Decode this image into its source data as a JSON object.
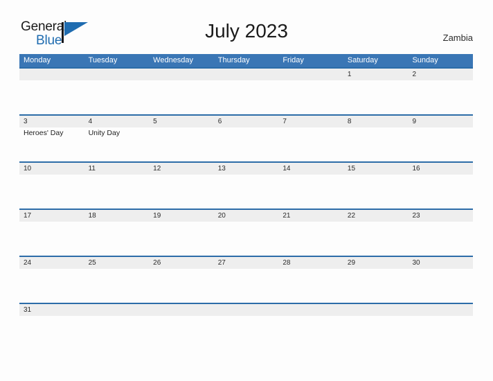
{
  "logo": {
    "word_one": "General",
    "word_two": "Blue",
    "triangle_color": "#1f6cb0",
    "icon": "general-blue-logo"
  },
  "header": {
    "title": "July 2023",
    "country": "Zambia"
  },
  "colors": {
    "header_blue": "#3a76b5",
    "row_rule_blue": "#2c6ca8",
    "date_band_gray": "#eeeeee",
    "page_background": "#fdfdfd"
  },
  "calendar": {
    "weekdays": [
      "Monday",
      "Tuesday",
      "Wednesday",
      "Thursday",
      "Friday",
      "Saturday",
      "Sunday"
    ],
    "weeks": [
      {
        "days": [
          {
            "date": "",
            "event": ""
          },
          {
            "date": "",
            "event": ""
          },
          {
            "date": "",
            "event": ""
          },
          {
            "date": "",
            "event": ""
          },
          {
            "date": "",
            "event": ""
          },
          {
            "date": "1",
            "event": ""
          },
          {
            "date": "2",
            "event": ""
          }
        ]
      },
      {
        "days": [
          {
            "date": "3",
            "event": "Heroes' Day"
          },
          {
            "date": "4",
            "event": "Unity Day"
          },
          {
            "date": "5",
            "event": ""
          },
          {
            "date": "6",
            "event": ""
          },
          {
            "date": "7",
            "event": ""
          },
          {
            "date": "8",
            "event": ""
          },
          {
            "date": "9",
            "event": ""
          }
        ]
      },
      {
        "days": [
          {
            "date": "10",
            "event": ""
          },
          {
            "date": "11",
            "event": ""
          },
          {
            "date": "12",
            "event": ""
          },
          {
            "date": "13",
            "event": ""
          },
          {
            "date": "14",
            "event": ""
          },
          {
            "date": "15",
            "event": ""
          },
          {
            "date": "16",
            "event": ""
          }
        ]
      },
      {
        "days": [
          {
            "date": "17",
            "event": ""
          },
          {
            "date": "18",
            "event": ""
          },
          {
            "date": "19",
            "event": ""
          },
          {
            "date": "20",
            "event": ""
          },
          {
            "date": "21",
            "event": ""
          },
          {
            "date": "22",
            "event": ""
          },
          {
            "date": "23",
            "event": ""
          }
        ]
      },
      {
        "days": [
          {
            "date": "24",
            "event": ""
          },
          {
            "date": "25",
            "event": ""
          },
          {
            "date": "26",
            "event": ""
          },
          {
            "date": "27",
            "event": ""
          },
          {
            "date": "28",
            "event": ""
          },
          {
            "date": "29",
            "event": ""
          },
          {
            "date": "30",
            "event": ""
          }
        ]
      },
      {
        "days": [
          {
            "date": "31",
            "event": ""
          },
          {
            "date": "",
            "event": ""
          },
          {
            "date": "",
            "event": ""
          },
          {
            "date": "",
            "event": ""
          },
          {
            "date": "",
            "event": ""
          },
          {
            "date": "",
            "event": ""
          },
          {
            "date": "",
            "event": ""
          }
        ]
      }
    ]
  }
}
